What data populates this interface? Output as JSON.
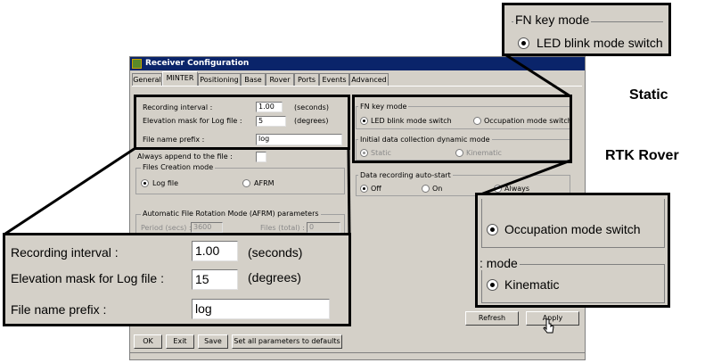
{
  "window": {
    "title": "Receiver Configuration",
    "tabs": [
      "General",
      "MINTER",
      "Positioning",
      "Base",
      "Rover",
      "Ports",
      "Events",
      "Advanced"
    ],
    "active_tab": "MINTER"
  },
  "minter": {
    "recording_interval_label": "Recording interval :",
    "recording_interval_value": "1.00",
    "recording_interval_unit": "(seconds)",
    "elevation_mask_label": "Elevation mask for Log file :",
    "elevation_mask_value": "5",
    "elevation_mask_unit": "(degrees)",
    "file_prefix_label": "File name prefix :",
    "file_prefix_value": "log",
    "always_append_label": "Always append to the file :",
    "files_creation_title": "Files Creation mode",
    "log_file_label": "Log file",
    "afrm_label": "AFRM",
    "afrm_title": "Automatic File Rotation Mode (AFRM) parameters",
    "afrm_period_label": "Period (secs) :",
    "afrm_period_value": "3600",
    "afrm_files_label": "Files (total) :",
    "afrm_files_value": "0",
    "fn_key_title": "FN key mode",
    "led_blink_label": "LED blink mode switch",
    "occupation_label": "Occupation mode switch",
    "initial_dyn_title": "Initial data collection dynamic mode",
    "static_label": "Static",
    "kinematic_label": "Kinematic",
    "auto_start_title": "Data recording auto-start",
    "off_label": "Off",
    "on_label": "On",
    "always_label": "Always",
    "refresh_label": "Refresh",
    "apply_label": "Apply"
  },
  "footer": {
    "ok_label": "OK",
    "exit_label": "Exit",
    "save_label": "Save",
    "defaults_label": "Set all parameters to defaults"
  },
  "callout_left": {
    "recording_interval_label": "Recording interval :",
    "recording_interval_value": "1.00",
    "recording_interval_unit": "(seconds)",
    "elevation_mask_label": "Elevation mask for Log file :",
    "elevation_mask_value": "15",
    "elevation_mask_unit": "(degrees)",
    "file_prefix_label": "File name prefix :",
    "file_prefix_value": "log"
  },
  "callout_static": {
    "group_title": "FN key mode",
    "option_label": "LED blink mode switch",
    "caption": "Static"
  },
  "callout_rover": {
    "caption": "RTK Rover",
    "occupation_label": "Occupation mode switch",
    "mode_title": "mode",
    "mode_prefix": ":",
    "kinematic_label": "Kinematic"
  }
}
